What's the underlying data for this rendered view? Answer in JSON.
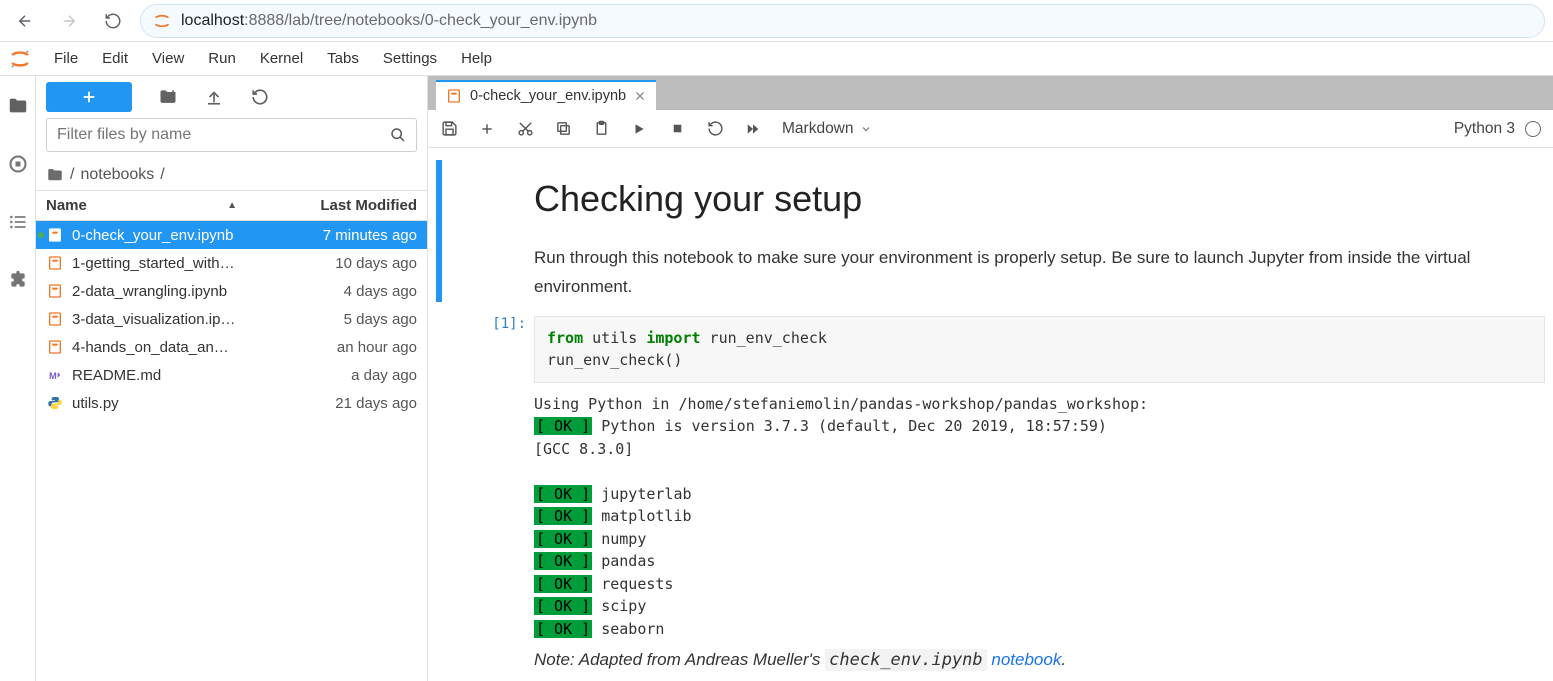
{
  "browser": {
    "url_host": "localhost",
    "url_port_path": ":8888/lab/tree/notebooks/0-check_your_env.ipynb"
  },
  "menubar": {
    "items": [
      "File",
      "Edit",
      "View",
      "Run",
      "Kernel",
      "Tabs",
      "Settings",
      "Help"
    ]
  },
  "sidebar": {
    "filter_placeholder": "Filter files by name",
    "breadcrumb_folder": "notebooks",
    "columns": {
      "name": "Name",
      "modified": "Last Modified"
    },
    "files": [
      {
        "name": "0-check_your_env.ipynb",
        "mod": "7 minutes ago",
        "type": "nb",
        "selected": true,
        "running": true
      },
      {
        "name": "1-getting_started_with…",
        "mod": "10 days ago",
        "type": "nb"
      },
      {
        "name": "2-data_wrangling.ipynb",
        "mod": "4 days ago",
        "type": "nb"
      },
      {
        "name": "3-data_visualization.ip…",
        "mod": "5 days ago",
        "type": "nb"
      },
      {
        "name": "4-hands_on_data_an…",
        "mod": "an hour ago",
        "type": "nb"
      },
      {
        "name": "README.md",
        "mod": "a day ago",
        "type": "md"
      },
      {
        "name": "utils.py",
        "mod": "21 days ago",
        "type": "py"
      }
    ]
  },
  "tab": {
    "title": "0-check_your_env.ipynb"
  },
  "nb_toolbar": {
    "celltype": "Markdown",
    "kernel": "Python 3"
  },
  "notebook": {
    "heading": "Checking your setup",
    "intro": "Run through this notebook to make sure your environment is properly setup. Be sure to launch Jupyter from inside the virtual environment.",
    "prompt": "[1]:",
    "code_kw_from": "from",
    "code_mod": " utils ",
    "code_kw_import": "import",
    "code_rest1": " run_env_check",
    "code_line2": "run_env_check()",
    "output_line1": "Using Python in /home/stefaniemolin/pandas-workshop/pandas_workshop:",
    "ok": "[ OK ]",
    "output_python": " Python is version 3.7.3 (default, Dec 20 2019, 18:57:59)",
    "output_gcc": "[GCC 8.3.0]",
    "pkgs": [
      " jupyterlab",
      " matplotlib",
      " numpy",
      " pandas",
      " requests",
      " scipy",
      " seaborn"
    ],
    "note_prefix": "Note: Adapted from Andreas Mueller's ",
    "note_code": "check_env.ipynb",
    "note_link": " notebook",
    "note_suffix": "."
  }
}
